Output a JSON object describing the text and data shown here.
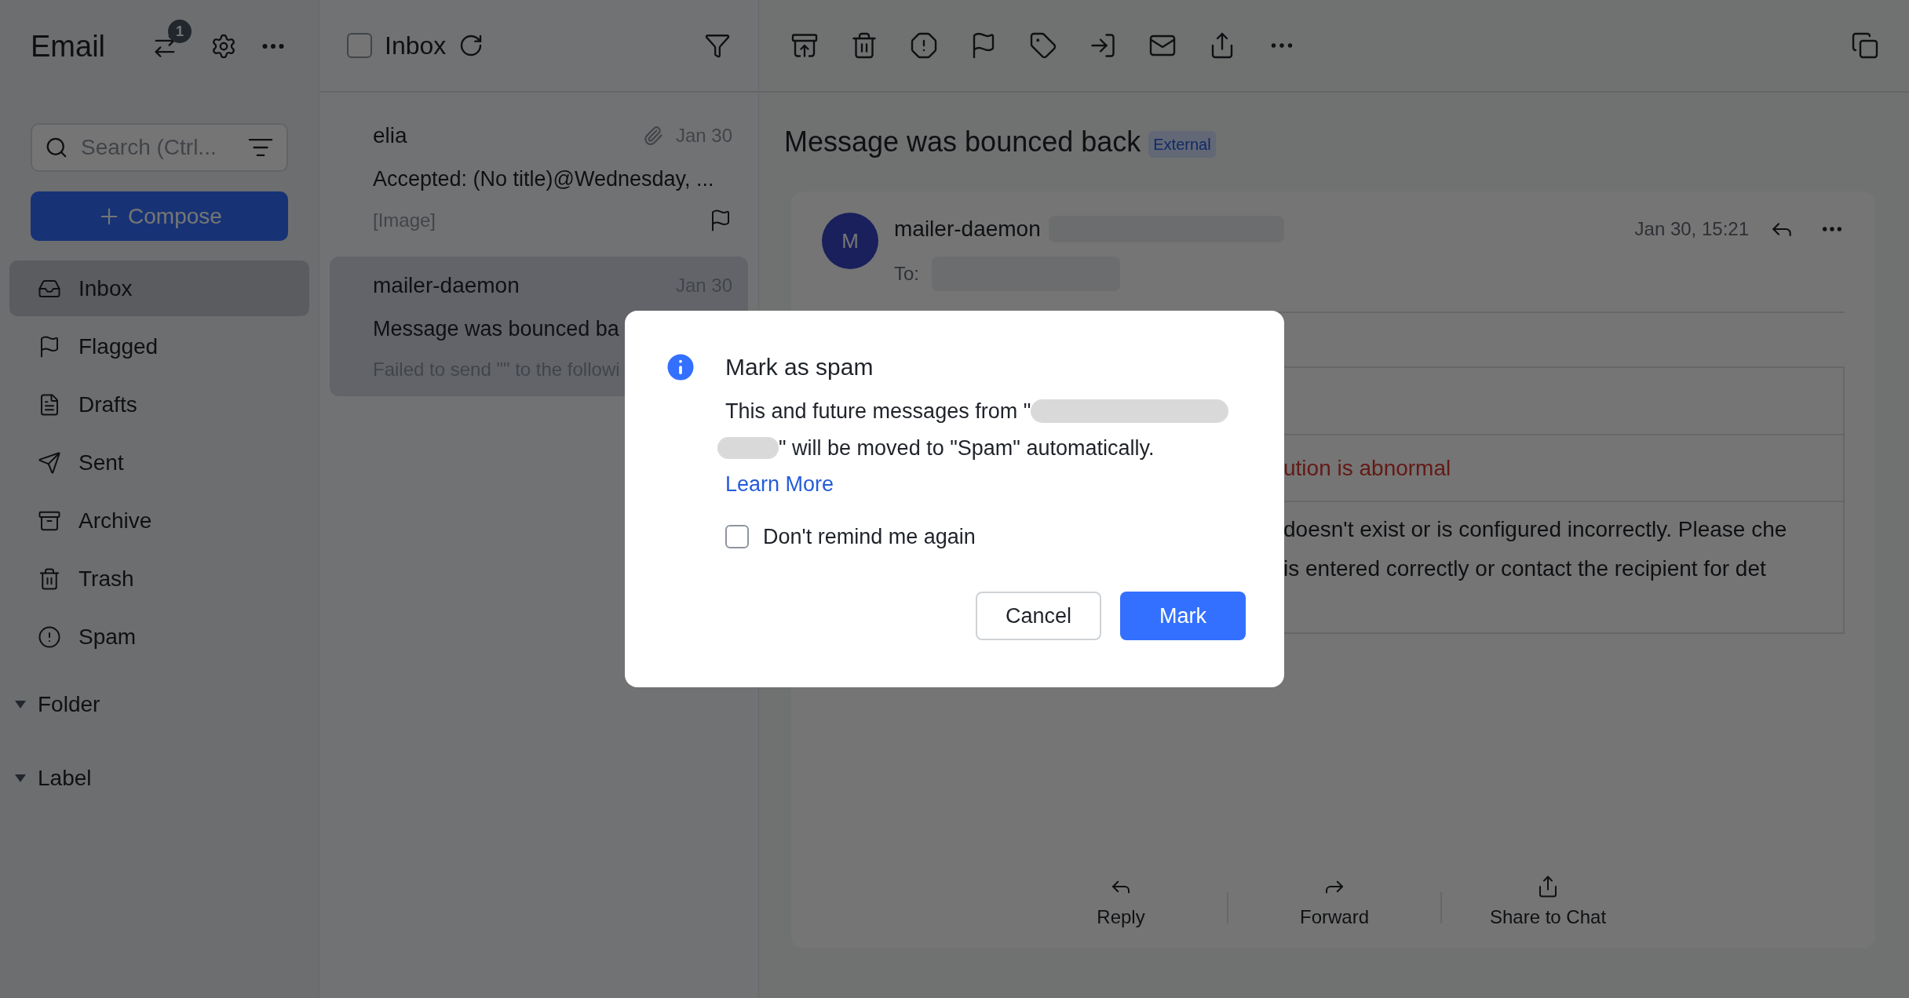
{
  "sidebar": {
    "title": "Email",
    "badge": "1",
    "search": {
      "placeholder": "Search (Ctrl..."
    },
    "compose": "Compose",
    "items": [
      {
        "label": "Inbox",
        "selected": true
      },
      {
        "label": "Flagged",
        "selected": false
      },
      {
        "label": "Drafts",
        "selected": false
      },
      {
        "label": "Sent",
        "selected": false
      },
      {
        "label": "Archive",
        "selected": false
      },
      {
        "label": "Trash",
        "selected": false
      },
      {
        "label": "Spam",
        "selected": false
      }
    ],
    "sections": [
      {
        "label": "Folder",
        "expanded": true
      },
      {
        "label": "Label",
        "expanded": true
      }
    ]
  },
  "mail_list": {
    "title": "Inbox",
    "select_all": false,
    "messages": [
      {
        "sender": "elia",
        "date": "Jan 30",
        "subject": "Accepted: (No title)@Wednesday, ...",
        "preview": "[Image]",
        "attachment": true,
        "selected": false
      },
      {
        "sender": "mailer-daemon",
        "date": "Jan 30",
        "subject": "Message was bounced ba",
        "preview": "Failed to send \"\" to the followi",
        "attachment": false,
        "selected": true
      }
    ]
  },
  "reading_pane": {
    "subject": "Message was bounced back",
    "tag": "External",
    "avatar": "M",
    "sender": "mailer-daemon",
    "time": "Jan 30, 15:21",
    "to_label": "To:",
    "body": [
      "ution is abnormal",
      "doesn't exist or is configured incorrectly. Please che",
      "is entered correctly or contact the recipient for det"
    ],
    "actions": [
      "Reply",
      "Forward",
      "Share to Chat"
    ]
  },
  "dialog": {
    "title": "Mark as spam",
    "text_before": "This and future messages from \"",
    "text_after": "\" will be moved to \"Spam\" automatically.",
    "link": "Learn More",
    "checkbox": {
      "label": "Don't remind me again",
      "checked": false
    },
    "buttons": [
      {
        "label": "Cancel",
        "kind": "secondary"
      },
      {
        "label": "Mark",
        "kind": "primary"
      }
    ]
  }
}
